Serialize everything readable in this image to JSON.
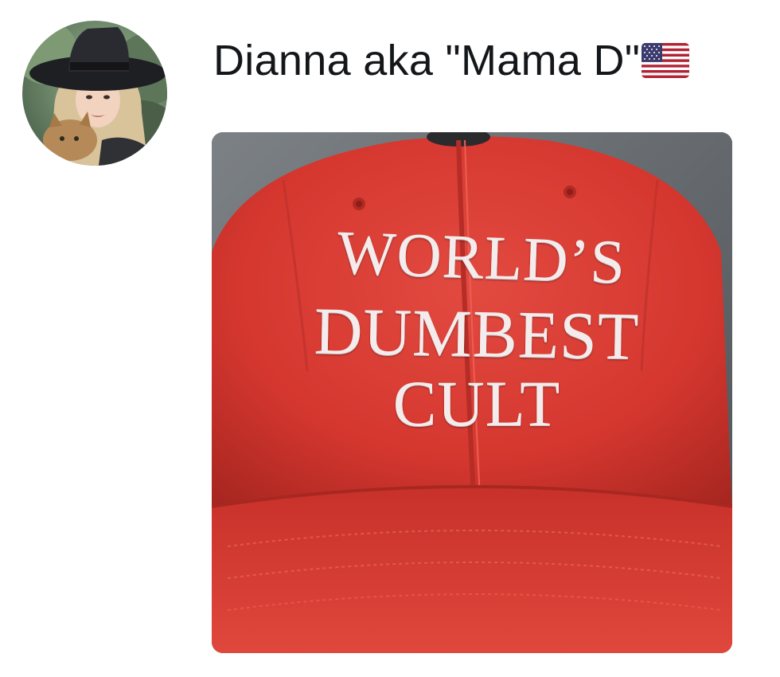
{
  "post": {
    "author": {
      "display_name": "Dianna aka \"Mama D\"",
      "flag_emoji": "us-flag-icon",
      "avatar_icon": "avatar-photo"
    },
    "media": {
      "cap_text": {
        "line1": "WORLD’S",
        "line2": "DUMBEST",
        "line3": "CULT"
      },
      "cap_color": "#d93a32"
    }
  }
}
